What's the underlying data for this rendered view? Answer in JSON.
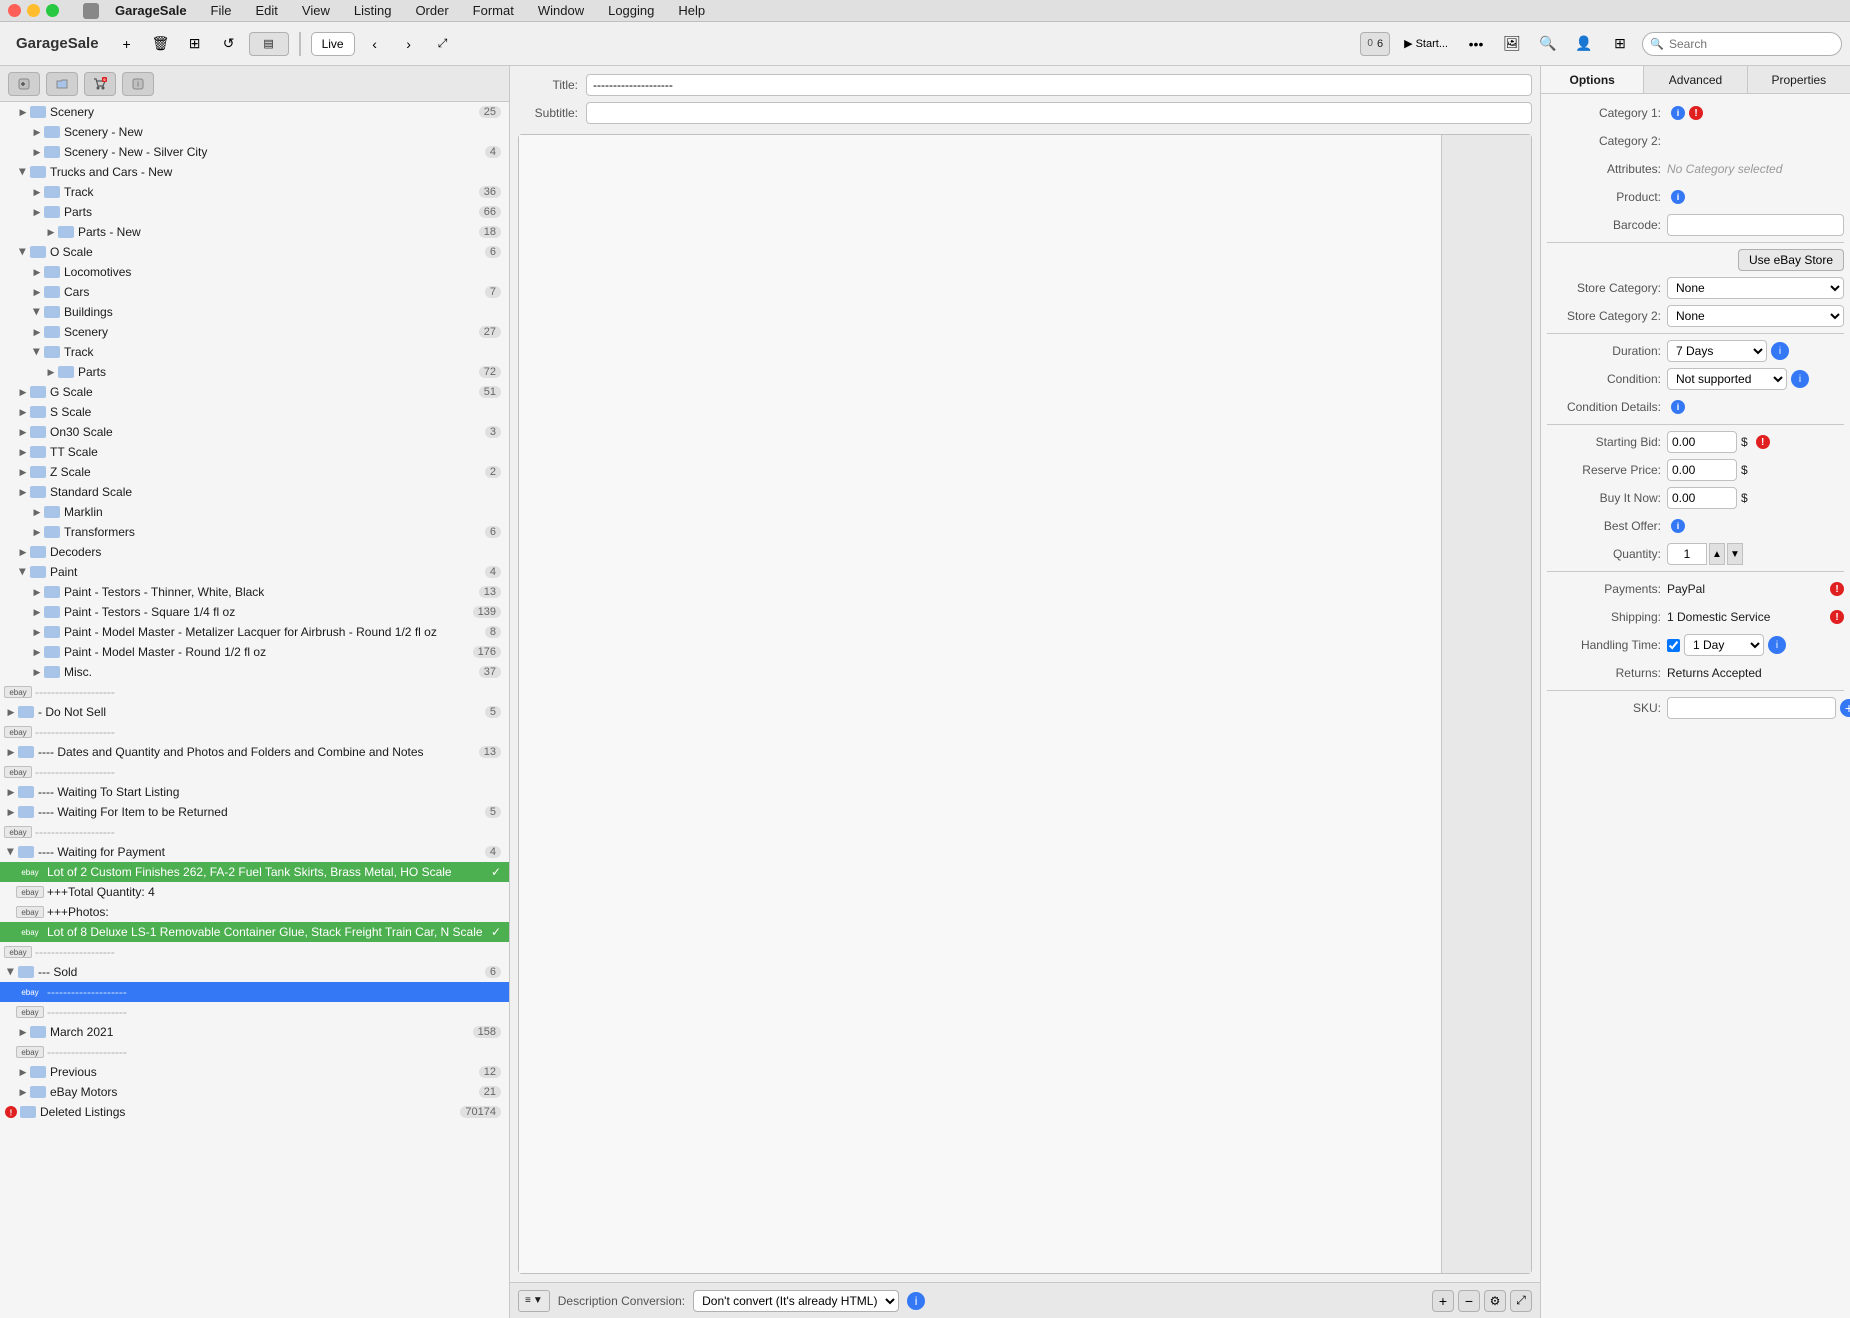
{
  "app": {
    "name": "GarageSale",
    "icon": "garage-sale-icon"
  },
  "menubar": {
    "items": [
      "File",
      "Edit",
      "View",
      "Listing",
      "Order",
      "Format",
      "Window",
      "Logging",
      "Help"
    ]
  },
  "toolbar": {
    "live_label": "Live",
    "search_placeholder": "Search"
  },
  "sidebar": {
    "items": [
      {
        "label": "Scenery",
        "count": "25",
        "indent": 1,
        "expanded": false,
        "type": "folder"
      },
      {
        "label": "Scenery - New",
        "count": "",
        "indent": 2,
        "expanded": false,
        "type": "folder"
      },
      {
        "label": "Scenery - New - Silver City",
        "count": "4",
        "indent": 2,
        "expanded": false,
        "type": "folder"
      },
      {
        "label": "Trucks and Cars - New",
        "count": "",
        "indent": 1,
        "expanded": true,
        "type": "folder"
      },
      {
        "label": "Track",
        "count": "36",
        "indent": 2,
        "expanded": false,
        "type": "folder"
      },
      {
        "label": "Parts",
        "count": "66",
        "indent": 2,
        "expanded": false,
        "type": "folder"
      },
      {
        "label": "Parts - New",
        "count": "18",
        "indent": 3,
        "expanded": false,
        "type": "folder"
      },
      {
        "label": "O Scale",
        "count": "6",
        "indent": 1,
        "expanded": true,
        "type": "folder"
      },
      {
        "label": "Locomotives",
        "count": "",
        "indent": 2,
        "expanded": false,
        "type": "folder"
      },
      {
        "label": "Cars",
        "count": "7",
        "indent": 2,
        "expanded": false,
        "type": "folder"
      },
      {
        "label": "Buildings",
        "count": "",
        "indent": 2,
        "expanded": true,
        "type": "folder"
      },
      {
        "label": "Scenery",
        "count": "27",
        "indent": 2,
        "expanded": false,
        "type": "folder"
      },
      {
        "label": "Track",
        "count": "",
        "indent": 2,
        "expanded": true,
        "type": "folder"
      },
      {
        "label": "Parts",
        "count": "72",
        "indent": 3,
        "expanded": false,
        "type": "folder"
      },
      {
        "label": "G Scale",
        "count": "51",
        "indent": 1,
        "expanded": false,
        "type": "folder"
      },
      {
        "label": "S Scale",
        "count": "",
        "indent": 1,
        "expanded": false,
        "type": "folder"
      },
      {
        "label": "On30 Scale",
        "count": "3",
        "indent": 1,
        "expanded": false,
        "type": "folder"
      },
      {
        "label": "TT Scale",
        "count": "",
        "indent": 1,
        "expanded": false,
        "type": "folder"
      },
      {
        "label": "Z Scale",
        "count": "2",
        "indent": 1,
        "expanded": false,
        "type": "folder"
      },
      {
        "label": "Standard Scale",
        "count": "",
        "indent": 1,
        "expanded": false,
        "type": "folder"
      },
      {
        "label": "Marklin",
        "count": "",
        "indent": 2,
        "expanded": false,
        "type": "folder"
      },
      {
        "label": "Transformers",
        "count": "6",
        "indent": 2,
        "expanded": false,
        "type": "folder"
      },
      {
        "label": "Decoders",
        "count": "",
        "indent": 1,
        "expanded": false,
        "type": "folder"
      },
      {
        "label": "Paint",
        "count": "4",
        "indent": 1,
        "expanded": true,
        "type": "folder"
      },
      {
        "label": "Paint - Testors - Thinner, White, Black",
        "count": "13",
        "indent": 2,
        "expanded": false,
        "type": "folder"
      },
      {
        "label": "Paint - Testors - Square 1/4 fl oz",
        "count": "139",
        "indent": 2,
        "expanded": false,
        "type": "folder"
      },
      {
        "label": "Paint - Model Master - Metalizer Lacquer for Airbrush - Round 1/2 fl oz",
        "count": "8",
        "indent": 2,
        "expanded": false,
        "type": "folder"
      },
      {
        "label": "Paint - Model Master - Round 1/2 fl oz",
        "count": "176",
        "indent": 2,
        "expanded": false,
        "type": "folder"
      },
      {
        "label": "Misc.",
        "count": "37",
        "indent": 2,
        "expanded": false,
        "type": "folder"
      },
      {
        "label": "--------------------",
        "count": "",
        "indent": 0,
        "expanded": false,
        "type": "separator",
        "ebay": true
      },
      {
        "label": "- Do Not Sell",
        "count": "5",
        "indent": 0,
        "expanded": false,
        "type": "folder"
      },
      {
        "label": "--------------------",
        "count": "",
        "indent": 0,
        "expanded": false,
        "type": "separator",
        "ebay": true
      },
      {
        "label": "---- Dates and Quantity and Photos and Folders and Combine and Notes",
        "count": "13",
        "indent": 0,
        "expanded": false,
        "type": "folder"
      },
      {
        "label": "--------------------",
        "count": "",
        "indent": 0,
        "expanded": false,
        "type": "separator",
        "ebay": true
      },
      {
        "label": "---- Waiting To Start Listing",
        "count": "",
        "indent": 0,
        "expanded": false,
        "type": "folder"
      },
      {
        "label": "---- Waiting For Item to be Returned",
        "count": "5",
        "indent": 0,
        "expanded": false,
        "type": "folder"
      },
      {
        "label": "--------------------",
        "count": "",
        "indent": 0,
        "expanded": false,
        "type": "separator",
        "ebay": true
      },
      {
        "label": "---- Waiting for Payment",
        "count": "4",
        "indent": 0,
        "expanded": true,
        "type": "folder"
      },
      {
        "label": "Lot of 2 Custom Finishes 262, FA-2 Fuel Tank Skirts, Brass Metal, HO Scale",
        "count": "",
        "indent": 1,
        "expanded": false,
        "type": "listing",
        "ebay": "green"
      },
      {
        "label": "+++Total Quantity: 4",
        "count": "",
        "indent": 1,
        "expanded": false,
        "type": "note",
        "ebay": true
      },
      {
        "label": "+++Photos:",
        "count": "",
        "indent": 1,
        "expanded": false,
        "type": "note",
        "ebay": true
      },
      {
        "label": "Lot of 8 Deluxe LS-1 Removable Container Glue, Stack Freight Train Car, N Scale",
        "count": "",
        "indent": 1,
        "expanded": false,
        "type": "listing",
        "ebay": "green"
      },
      {
        "label": "--------------------",
        "count": "",
        "indent": 0,
        "expanded": false,
        "type": "separator",
        "ebay": true
      },
      {
        "label": "--- Sold",
        "count": "6",
        "indent": 0,
        "expanded": true,
        "type": "folder"
      },
      {
        "label": "--------------------",
        "count": "",
        "indent": 1,
        "expanded": false,
        "type": "separator",
        "ebay": true,
        "selected": true
      },
      {
        "label": "--------------------",
        "count": "",
        "indent": 1,
        "expanded": false,
        "type": "separator",
        "ebay": true
      },
      {
        "label": "March 2021",
        "count": "158",
        "indent": 1,
        "expanded": false,
        "type": "folder"
      },
      {
        "label": "--------------------",
        "count": "",
        "indent": 1,
        "expanded": false,
        "type": "separator",
        "ebay": true
      },
      {
        "label": "Previous",
        "count": "12",
        "indent": 1,
        "expanded": false,
        "type": "folder"
      },
      {
        "label": "eBay Motors",
        "count": "21",
        "indent": 1,
        "expanded": false,
        "type": "folder"
      },
      {
        "label": "Deleted Listings",
        "count": "70174",
        "indent": 0,
        "expanded": false,
        "type": "folder"
      }
    ]
  },
  "content": {
    "title_label": "Title:",
    "title_value": "--------------------",
    "subtitle_label": "Subtitle:",
    "subtitle_value": "",
    "description_conversion_label": "Description Conversion:",
    "description_conversion_value": "Don't convert (It's already HTML)"
  },
  "right_panel": {
    "tabs": [
      "Options",
      "Advanced",
      "Properties"
    ],
    "active_tab": "Options",
    "fields": {
      "category1_label": "Category 1:",
      "category2_label": "Category 2:",
      "attributes_label": "Attributes:",
      "attributes_value": "No Category selected",
      "product_label": "Product:",
      "barcode_label": "Barcode:",
      "use_store_label": "Use eBay Store",
      "store_category_label": "Store Category:",
      "store_category_value": "None",
      "store_category2_label": "Store Category 2:",
      "store_category2_value": "None",
      "duration_label": "Duration:",
      "duration_value": "7 Days",
      "condition_label": "Condition:",
      "condition_value": "Not supported",
      "condition_details_label": "Condition Details:",
      "starting_bid_label": "Starting Bid:",
      "starting_bid_value": "0.00",
      "reserve_price_label": "Reserve Price:",
      "reserve_price_value": "0.00",
      "buy_it_now_label": "Buy It Now:",
      "buy_it_now_value": "0.00",
      "best_offer_label": "Best Offer:",
      "quantity_label": "Quantity:",
      "quantity_value": "1",
      "payments_label": "Payments:",
      "payments_value": "PayPal",
      "shipping_label": "Shipping:",
      "shipping_value": "1 Domestic Service",
      "handling_time_label": "Handling Time:",
      "handling_time_value": "1 Day",
      "returns_label": "Returns:",
      "returns_value": "Returns Accepted",
      "sku_label": "SKU:"
    }
  }
}
